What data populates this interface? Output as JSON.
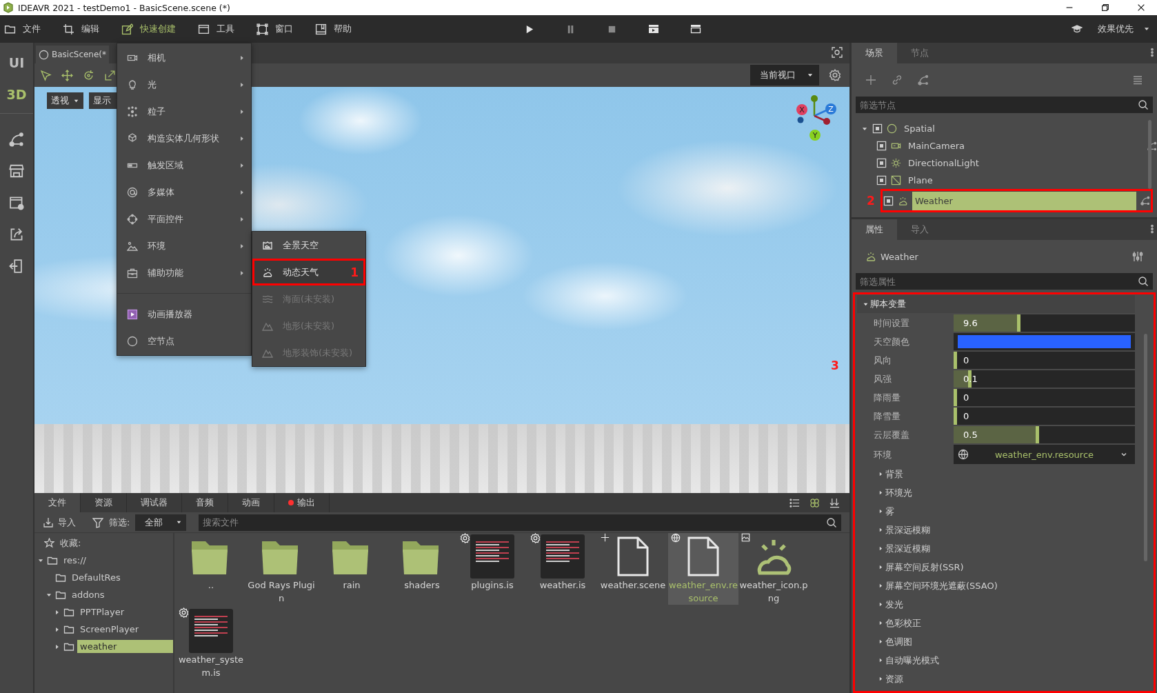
{
  "window": {
    "title": "IDEAVR 2021 - testDemo1 - BasicScene.scene (*)"
  },
  "menubar": [
    {
      "label": "文件",
      "selected": false
    },
    {
      "label": "编辑",
      "selected": false
    },
    {
      "label": "快速创建",
      "selected": true
    },
    {
      "label": "工具",
      "selected": false
    },
    {
      "label": "窗口",
      "selected": false
    },
    {
      "label": "帮助",
      "selected": false
    }
  ],
  "quality_mode": {
    "label": "效果优先"
  },
  "side_modes": [
    {
      "label": "UI",
      "selected": false
    },
    {
      "label": "3D",
      "selected": true
    }
  ],
  "scene_tab": {
    "title": "BasicScene(*"
  },
  "viewport": {
    "view_mode": "透视",
    "display": "显示",
    "camera": "当前视口",
    "axes": [
      "X",
      "Y",
      "Z"
    ]
  },
  "quick_create_menu": {
    "items": [
      {
        "label": "相机",
        "kind": "submenu"
      },
      {
        "label": "光",
        "kind": "submenu"
      },
      {
        "label": "粒子",
        "kind": "submenu"
      },
      {
        "label": "构造实体几何形状",
        "kind": "submenu"
      },
      {
        "label": "触发区域",
        "kind": "submenu"
      },
      {
        "label": "多媒体",
        "kind": "submenu"
      },
      {
        "label": "平面控件",
        "kind": "submenu"
      },
      {
        "label": "环境",
        "kind": "submenu"
      },
      {
        "label": "辅助功能",
        "kind": "submenu"
      },
      {
        "label": "动画播放器",
        "kind": "action"
      },
      {
        "label": "空节点",
        "kind": "action"
      }
    ],
    "submenu": [
      {
        "label": "全景天空",
        "selected": false,
        "disabled": false
      },
      {
        "label": "动态天气",
        "selected": true,
        "disabled": false,
        "annotation": "1"
      },
      {
        "label": "海面(未安装)",
        "selected": false,
        "disabled": true
      },
      {
        "label": "地形(未安装)",
        "selected": false,
        "disabled": true
      },
      {
        "label": "地形装饰(未安装)",
        "selected": false,
        "disabled": true
      }
    ]
  },
  "scene_dock": {
    "tabs": [
      {
        "label": "场景",
        "selected": true
      },
      {
        "label": "节点",
        "selected": false
      }
    ],
    "filter_placeholder": "筛选节点",
    "tree": [
      {
        "label": "Spatial",
        "kind": "spatial",
        "expanded": true,
        "selected": false,
        "has_script": false,
        "children": [
          {
            "label": "MainCamera",
            "kind": "camera",
            "selected": false,
            "has_script": true
          },
          {
            "label": "DirectionalLight",
            "kind": "light",
            "selected": false,
            "has_script": false
          },
          {
            "label": "Plane",
            "kind": "mesh",
            "selected": false,
            "has_script": false
          },
          {
            "label": "Weather",
            "kind": "weather",
            "selected": true,
            "has_script": true,
            "annotation": "2"
          }
        ]
      }
    ]
  },
  "inspector": {
    "tabs": [
      {
        "label": "属性",
        "selected": true
      },
      {
        "label": "导入",
        "selected": false
      }
    ],
    "node_label": "Weather",
    "filter_placeholder": "筛选属性",
    "section": {
      "label": "脚本变量",
      "expanded": true,
      "annotation": "3",
      "properties": [
        {
          "kind": "slider",
          "label": "时间设置",
          "value": "9.6",
          "level": 0.37
        },
        {
          "kind": "color",
          "label": "天空颜色",
          "color": "#2962ff"
        },
        {
          "kind": "slider",
          "label": "风向",
          "value": "0",
          "level": 0
        },
        {
          "kind": "slider",
          "label": "风强",
          "value": "0.1",
          "level": 0.1
        },
        {
          "kind": "slider",
          "label": "降雨量",
          "value": "0",
          "level": 0
        },
        {
          "kind": "slider",
          "label": "降雪量",
          "value": "0",
          "level": 0
        },
        {
          "kind": "slider",
          "label": "云层覆盖",
          "value": "0.5",
          "level": 0.47
        },
        {
          "kind": "resource",
          "label": "环境",
          "value": "weather_env.resource"
        }
      ],
      "groups": [
        {
          "label": "背景",
          "expanded": false
        },
        {
          "label": "环境光",
          "expanded": false
        },
        {
          "label": "雾",
          "expanded": false
        },
        {
          "label": "景深远模糊",
          "expanded": false
        },
        {
          "label": "景深近模糊",
          "expanded": false
        },
        {
          "label": "屏幕空间反射(SSR)",
          "expanded": false
        },
        {
          "label": "屏幕空间环境光遮蔽(SSAO)",
          "expanded": false
        },
        {
          "label": "发光",
          "expanded": false
        },
        {
          "label": "色彩校正",
          "expanded": false
        },
        {
          "label": "色调图",
          "expanded": false
        },
        {
          "label": "自动曝光模式",
          "expanded": false
        },
        {
          "label": "资源",
          "expanded": false
        }
      ]
    }
  },
  "file_panel": {
    "tabs": [
      {
        "label": "文件",
        "selected": true,
        "alert": false
      },
      {
        "label": "资源",
        "selected": false,
        "alert": false
      },
      {
        "label": "调试器",
        "selected": false,
        "alert": false
      },
      {
        "label": "音频",
        "selected": false,
        "alert": false
      },
      {
        "label": "动画",
        "selected": false,
        "alert": false
      },
      {
        "label": "输出",
        "selected": false,
        "alert": true
      }
    ],
    "import_label": "导入",
    "filter_label": "筛选:",
    "filter_value": "全部",
    "search_placeholder": "搜索文件",
    "favorites_label": "收藏:",
    "tree": [
      {
        "label": "res://",
        "has_children": true,
        "expanded": true,
        "selected": false,
        "children": [
          {
            "label": "DefaultRes",
            "has_children": false,
            "selected": false
          },
          {
            "label": "addons",
            "has_children": true,
            "expanded": true,
            "selected": false,
            "children": [
              {
                "label": "PPTPlayer",
                "has_children": true,
                "expanded": false,
                "selected": false
              },
              {
                "label": "ScreenPlayer",
                "has_children": true,
                "expanded": false,
                "selected": false
              },
              {
                "label": "weather",
                "has_children": true,
                "expanded": false,
                "selected": true
              }
            ]
          }
        ]
      }
    ],
    "files": [
      {
        "kind": "folder",
        "name": "..",
        "selected": false
      },
      {
        "kind": "folder",
        "name": "God Rays Plugin",
        "selected": false
      },
      {
        "kind": "folder",
        "name": "rain",
        "selected": false
      },
      {
        "kind": "folder",
        "name": "shaders",
        "selected": false
      },
      {
        "kind": "script",
        "name": "plugins.is",
        "selected": false
      },
      {
        "kind": "script",
        "name": "weather.is",
        "selected": false
      },
      {
        "kind": "scene",
        "name": "weather.scene",
        "selected": false
      },
      {
        "kind": "resource",
        "name": "weather_env.resource",
        "selected": true
      },
      {
        "kind": "image",
        "name": "weather_icon.png",
        "selected": false
      },
      {
        "kind": "script",
        "name": "weather_system.is",
        "selected": false
      }
    ]
  }
}
